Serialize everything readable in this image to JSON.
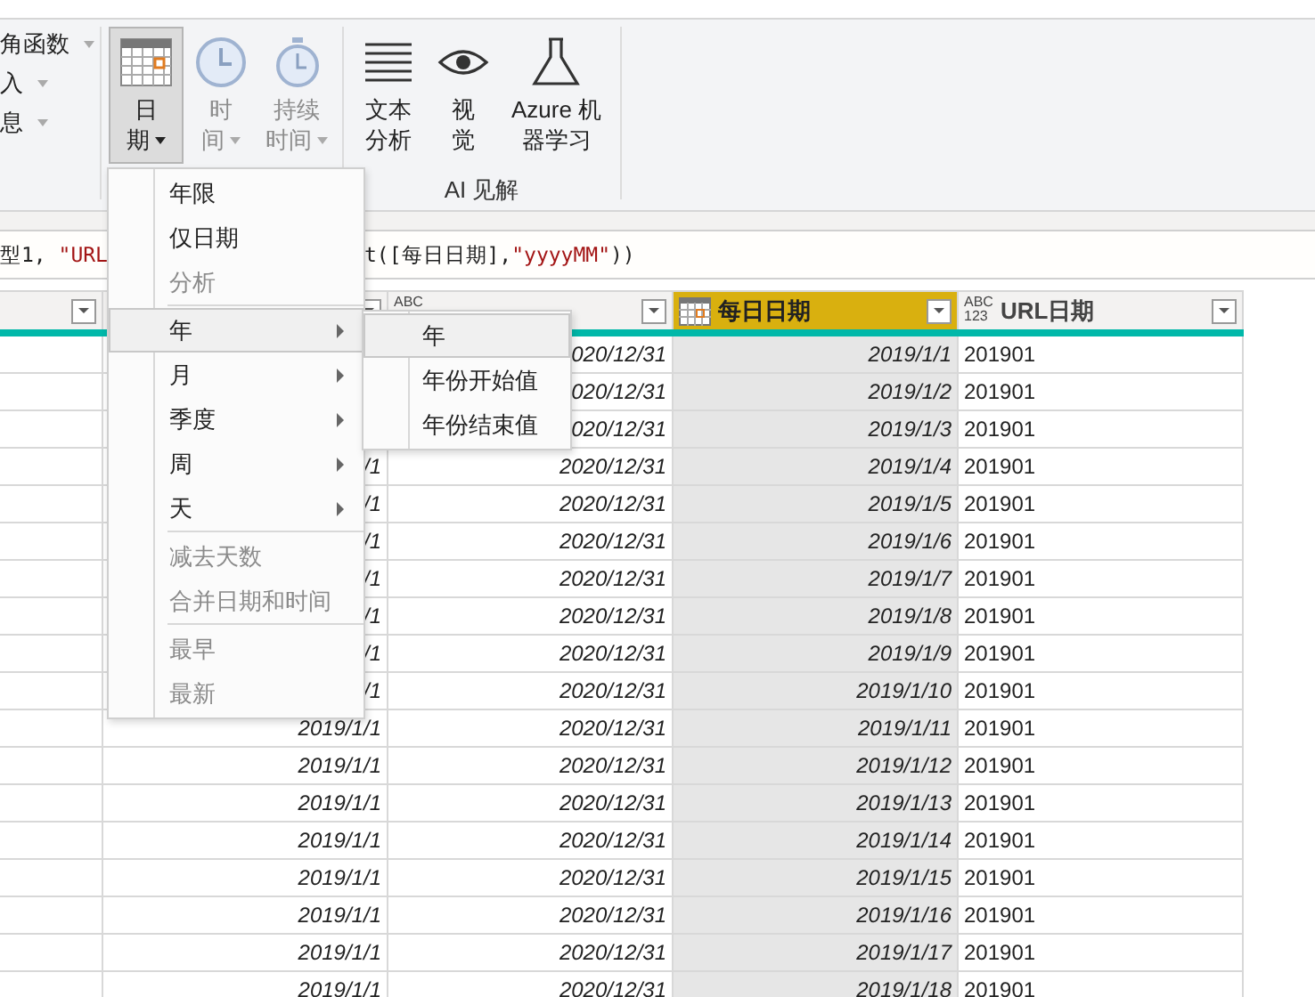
{
  "ribbon": {
    "cut_items": [
      {
        "label": "角函数"
      },
      {
        "label": "入"
      },
      {
        "label": "息"
      }
    ],
    "buttons": [
      {
        "kind": "calendar",
        "lines": [
          "日",
          "期"
        ],
        "dropdown": true,
        "selected": true,
        "disabled": false
      },
      {
        "kind": "clock",
        "lines": [
          "时",
          "间"
        ],
        "dropdown": true,
        "selected": false,
        "disabled": true
      },
      {
        "kind": "stopwatch",
        "lines": [
          "持续",
          "时间"
        ],
        "dropdown": true,
        "selected": false,
        "disabled": true
      }
    ],
    "ai_group": {
      "label": "AI 见解",
      "buttons": [
        {
          "kind": "lines",
          "lines": [
            "文本",
            "分析"
          ]
        },
        {
          "kind": "eye",
          "lines": [
            "视",
            "觉"
          ]
        },
        {
          "kind": "flask",
          "lines": [
            "Azure 机",
            "器学习"
          ]
        }
      ]
    }
  },
  "formula": {
    "left": [
      {
        "kind": "code",
        "text": "型1, "
      },
      {
        "kind": "string",
        "text": "\"URL"
      }
    ],
    "right": [
      {
        "kind": "code",
        "text": "t([每日日期],"
      },
      {
        "kind": "string",
        "text": "\"yyyyMM\""
      },
      {
        "kind": "code",
        "text": "))"
      }
    ]
  },
  "columns": [
    {
      "kind": "blank",
      "selected": false
    },
    {
      "kind": "blank",
      "selected": false
    },
    {
      "kind": "text",
      "type_badge": [
        "ABC"
      ],
      "selected": false
    },
    {
      "kind": "date",
      "label": "每日日期",
      "selected": true
    },
    {
      "kind": "any",
      "type_badge": [
        "ABC",
        "123"
      ],
      "label": "URL日期",
      "selected": false
    }
  ],
  "rows": [
    {
      "c": "020/12/31",
      "d": "2019/1/1",
      "e": "201901"
    },
    {
      "c": "020/12/31",
      "d": "2019/1/2",
      "e": "201901"
    },
    {
      "c": "020/12/31",
      "d": "2019/1/3",
      "e": "201901"
    },
    {
      "b": "/1",
      "c": "2020/12/31",
      "d": "2019/1/4",
      "e": "201901"
    },
    {
      "b": "/1",
      "c": "2020/12/31",
      "d": "2019/1/5",
      "e": "201901"
    },
    {
      "b": "/1",
      "c": "2020/12/31",
      "d": "2019/1/6",
      "e": "201901"
    },
    {
      "b": "/1",
      "c": "2020/12/31",
      "d": "2019/1/7",
      "e": "201901"
    },
    {
      "b": "/1",
      "c": "2020/12/31",
      "d": "2019/1/8",
      "e": "201901"
    },
    {
      "b": "/1",
      "c": "2020/12/31",
      "d": "2019/1/9",
      "e": "201901"
    },
    {
      "b": "/1",
      "c": "2020/12/31",
      "d": "2019/1/10",
      "e": "201901"
    },
    {
      "b": "2019/1/1",
      "c": "2020/12/31",
      "d": "2019/1/11",
      "e": "201901"
    },
    {
      "b": "2019/1/1",
      "c": "2020/12/31",
      "d": "2019/1/12",
      "e": "201901"
    },
    {
      "b": "2019/1/1",
      "c": "2020/12/31",
      "d": "2019/1/13",
      "e": "201901"
    },
    {
      "b": "2019/1/1",
      "c": "2020/12/31",
      "d": "2019/1/14",
      "e": "201901"
    },
    {
      "b": "2019/1/1",
      "c": "2020/12/31",
      "d": "2019/1/15",
      "e": "201901"
    },
    {
      "b": "2019/1/1",
      "c": "2020/12/31",
      "d": "2019/1/16",
      "e": "201901"
    },
    {
      "b": "2019/1/1",
      "c": "2020/12/31",
      "d": "2019/1/17",
      "e": "201901"
    },
    {
      "b": "2019/1/1",
      "c": "2020/12/31",
      "d": "2019/1/18",
      "e": "201901"
    }
  ],
  "menu": {
    "items": [
      {
        "kind": "item",
        "label": "年限",
        "disabled": false,
        "selected": false,
        "submenu": false
      },
      {
        "kind": "item",
        "label": "仅日期",
        "disabled": false,
        "selected": false,
        "submenu": false
      },
      {
        "kind": "item",
        "label": "分析",
        "disabled": true,
        "selected": false,
        "submenu": false
      },
      {
        "kind": "separator"
      },
      {
        "kind": "item",
        "label": "年",
        "disabled": false,
        "selected": true,
        "submenu": true
      },
      {
        "kind": "item",
        "label": "月",
        "disabled": false,
        "selected": false,
        "submenu": true
      },
      {
        "kind": "item",
        "label": "季度",
        "disabled": false,
        "selected": false,
        "submenu": true
      },
      {
        "kind": "item",
        "label": "周",
        "disabled": false,
        "selected": false,
        "submenu": true
      },
      {
        "kind": "item",
        "label": "天",
        "disabled": false,
        "selected": false,
        "submenu": true
      },
      {
        "kind": "separator"
      },
      {
        "kind": "item",
        "label": "减去天数",
        "disabled": true,
        "selected": false,
        "submenu": false
      },
      {
        "kind": "item",
        "label": "合并日期和时间",
        "disabled": true,
        "selected": false,
        "submenu": false
      },
      {
        "kind": "separator"
      },
      {
        "kind": "item",
        "label": "最早",
        "disabled": true,
        "selected": false,
        "submenu": false
      },
      {
        "kind": "item",
        "label": "最新",
        "disabled": true,
        "selected": false,
        "submenu": false
      }
    ]
  },
  "submenu": {
    "items": [
      {
        "label": "年",
        "selected": true
      },
      {
        "label": "年份开始值",
        "selected": false
      },
      {
        "label": "年份结束值",
        "selected": false
      }
    ]
  }
}
